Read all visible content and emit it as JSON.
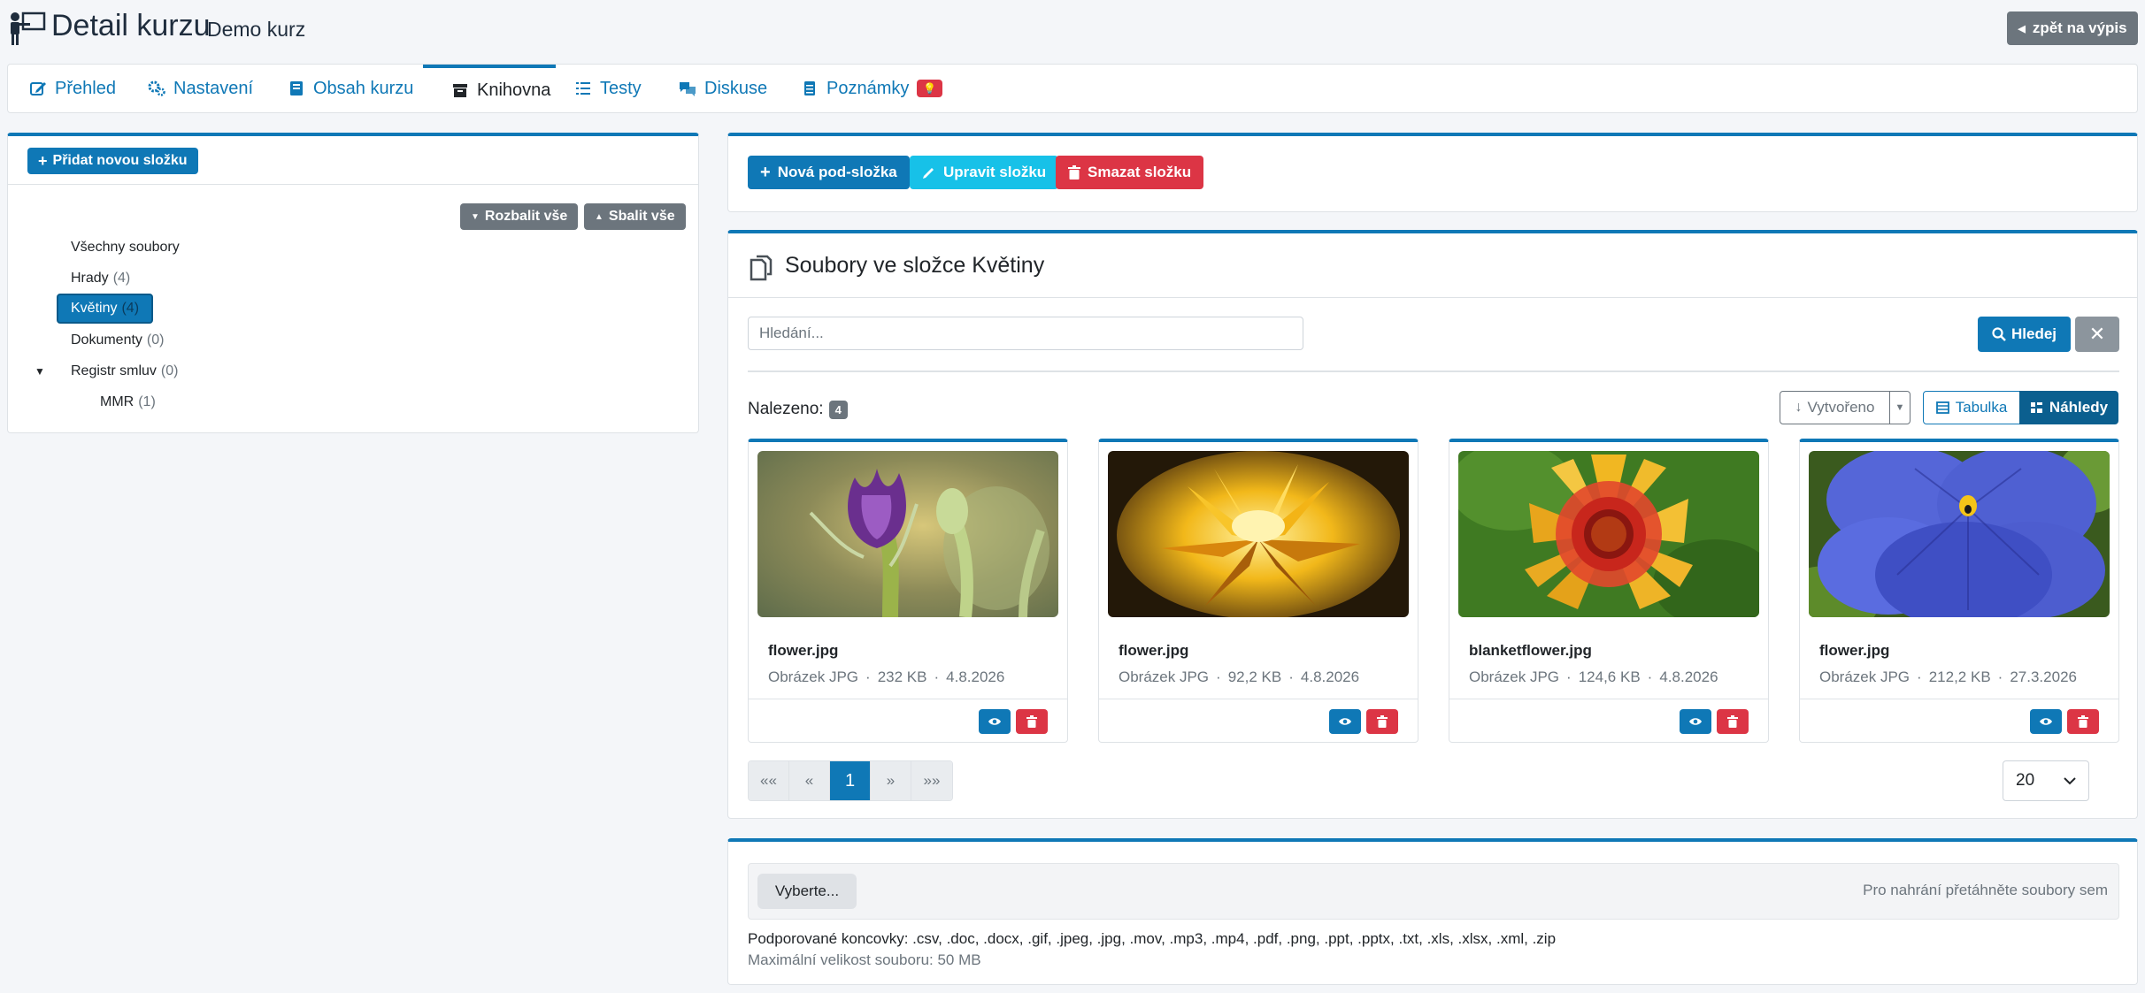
{
  "header": {
    "title": "Detail kurzu",
    "subtitle": "Demo kurz",
    "back_label": "zpět na výpis"
  },
  "tabs": [
    {
      "label": "Přehled",
      "icon": "edit-icon",
      "active": false
    },
    {
      "label": "Nastavení",
      "icon": "gears-icon",
      "active": false
    },
    {
      "label": "Obsah kurzu",
      "icon": "book-icon",
      "active": false
    },
    {
      "label": "Knihovna",
      "icon": "archive-icon",
      "active": true
    },
    {
      "label": "Testy",
      "icon": "list-icon",
      "active": false
    },
    {
      "label": "Diskuse",
      "icon": "comments-icon",
      "active": false
    },
    {
      "label": "Poznámky",
      "icon": "notes-icon",
      "active": false,
      "badge": "💡"
    }
  ],
  "folders": {
    "add_label": "Přidat novou složku",
    "expand_label": "Rozbalit vše",
    "collapse_label": "Sbalit vše",
    "items": [
      {
        "label": "Všechny soubory",
        "count": ""
      },
      {
        "label": "Hrady",
        "count": "(4)"
      },
      {
        "label": "Květiny",
        "count": "(4)",
        "selected": true
      },
      {
        "label": "Dokumenty",
        "count": "(0)"
      },
      {
        "label": "Registr smluv",
        "count": "(0)",
        "expanded": true
      },
      {
        "label": "MMR",
        "count": "(1)"
      }
    ]
  },
  "actions": {
    "new_subfolder": "Nová pod-složka",
    "edit_folder": "Upravit složku",
    "delete_folder": "Smazat složku"
  },
  "files": {
    "title": "Soubory ve složce Květiny",
    "search_placeholder": "Hledání...",
    "search_label": "Hledej",
    "found_label": "Nalezeno:",
    "found_count": "4",
    "sort_label": "Vytvořeno",
    "view_table_label": "Tabulka",
    "view_thumbs_label": "Náhledy",
    "items": [
      {
        "name": "flower.jpg",
        "type": "Obrázek JPG",
        "size": "232 KB",
        "date": "4.8.2026"
      },
      {
        "name": "flower.jpg",
        "type": "Obrázek JPG",
        "size": "92,2 KB",
        "date": "4.8.2026"
      },
      {
        "name": "blanketflower.jpg",
        "type": "Obrázek JPG",
        "size": "124,6 KB",
        "date": "4.8.2026"
      },
      {
        "name": "flower.jpg",
        "type": "Obrázek JPG",
        "size": "212,2 KB",
        "date": "27.3.2026"
      }
    ],
    "meta_separator": "·"
  },
  "pagination": {
    "first": "««",
    "prev": "«",
    "current": "1",
    "next": "»",
    "last": "»»",
    "page_size": "20"
  },
  "upload": {
    "choose_label": "Vyberte...",
    "drop_hint": "Pro nahrání přetáhněte soubory sem",
    "supported_ext": "Podporované koncovky: .csv, .doc, .docx, .gif, .jpeg, .jpg, .mov, .mp3, .mp4, .pdf, .png, .ppt, .pptx, .txt, .xls, .xlsx, .xml, .zip",
    "max_size": "Maximální velikost souboru: 50 MB"
  },
  "colors": {
    "primary": "#0f78b6",
    "info": "#17c1e8",
    "danger": "#dc3545",
    "secondary": "#6c757d"
  }
}
